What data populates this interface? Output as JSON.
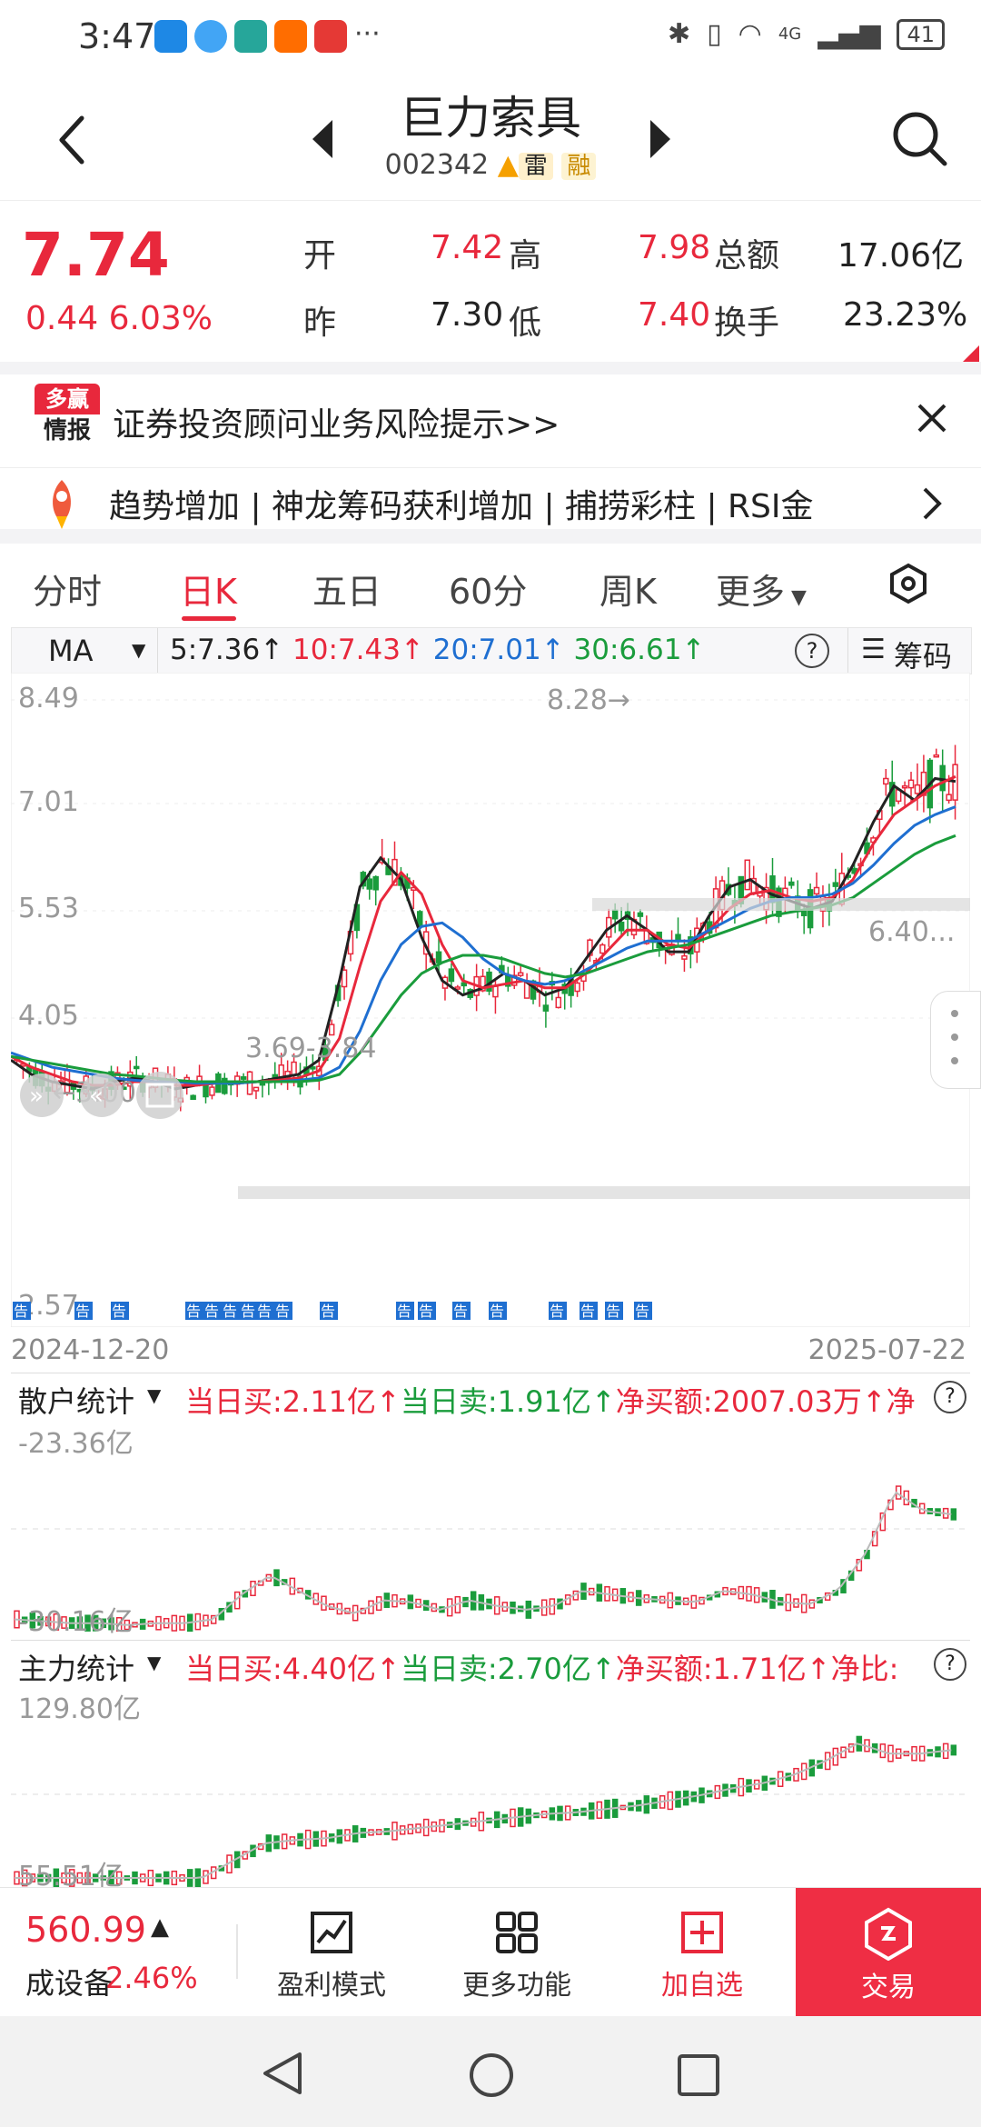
{
  "status": {
    "time": "3:47",
    "more": "···",
    "network": "4G",
    "battery": "41"
  },
  "header": {
    "name": "巨力索具",
    "code": "002342",
    "tag_lei": "雷",
    "tag_rong": "融"
  },
  "quote": {
    "price": "7.74",
    "change": "0.44",
    "change_pct": "6.03%",
    "open_label": "开",
    "open": "7.42",
    "high_label": "高",
    "high": "7.98",
    "amount_label": "总额",
    "amount": "17.06亿",
    "prev_label": "昨",
    "prev": "7.30",
    "low_label": "低",
    "low": "7.40",
    "turnover_label": "换手",
    "turnover": "23.23%"
  },
  "risk_banner": {
    "logo_top": "多赢",
    "logo_bottom": "情报",
    "text": "证券投资顾问业务风险提示>>"
  },
  "signal_banner": {
    "text": "趋势增加 | 神龙筹码获利增加 | 捕捞彩柱 | RSI金"
  },
  "tabs": [
    "分时",
    "日K",
    "五日",
    "60分",
    "周K",
    "更多"
  ],
  "ma_bar": {
    "label": "MA",
    "ma5": "5:7.36↑",
    "ma10": "10:7.43↑",
    "ma20": "20:7.01↑",
    "ma30": "30:6.61↑",
    "help": "?",
    "chips": "筹码"
  },
  "kline": {
    "y_labels": [
      "8.49",
      "7.01",
      "5.53",
      "4.05",
      "2.57"
    ],
    "high_marker": "8.28→",
    "low_marker": "←3.00",
    "band_upper": "6.40...",
    "band_lower": "3.69-3.84",
    "notice": "告",
    "start_date": "2024-12-20",
    "end_date": "2025-07-22"
  },
  "retail": {
    "title": "散户统计",
    "buy": "当日买:2.11亿↑",
    "sell": "当日卖:1.91亿↑",
    "net": "净买额:2007.03万↑",
    "net_more": "净",
    "y_top": "-23.36亿",
    "y_bottom": "-30.16亿",
    "help": "?"
  },
  "main_force": {
    "title": "主力统计",
    "buy": "当日买:4.40亿↑",
    "sell": "当日卖:2.70亿↑",
    "net": "净买额:1.71亿↑",
    "net_more": "净比:",
    "y_top": "129.80亿",
    "y_bottom": "55.51亿",
    "help": "?"
  },
  "bottom_bar": {
    "index_value": "560.99",
    "index_name": "成设备",
    "index_pct": "2.46%",
    "btn1": "盈利模式",
    "btn2": "更多功能",
    "btn3": "加自选",
    "btn4": "交易"
  },
  "chart_data": {
    "type": "candlestick",
    "title": "",
    "x_range": [
      "2024-12-20",
      "2025-07-22"
    ],
    "ylim": [
      2.57,
      8.49
    ],
    "y_ticks": [
      8.49,
      7.01,
      5.53,
      4.05,
      2.57
    ],
    "annotations": [
      {
        "label": "8.28→",
        "value": 8.28
      },
      {
        "label": "←3.00",
        "value": 3.0
      },
      {
        "label": "6.40...",
        "value": 6.4
      },
      {
        "label": "3.69-3.84",
        "range": [
          3.69,
          3.84
        ]
      }
    ],
    "series": [
      {
        "name": "5",
        "last": 7.36,
        "color": "#222222",
        "values": [
          3.5,
          3.3,
          3.2,
          3.15,
          3.1,
          3.2,
          3.25,
          3.2,
          3.1,
          3.15,
          3.2,
          3.18,
          3.2,
          3.25,
          3.3,
          3.5,
          4.6,
          5.9,
          6.3,
          6.0,
          5.2,
          4.6,
          4.4,
          4.5,
          4.7,
          4.6,
          4.4,
          4.5,
          4.9,
          5.3,
          5.5,
          5.3,
          5.0,
          5.0,
          5.5,
          5.9,
          6.0,
          5.8,
          5.7,
          5.6,
          5.7,
          6.2,
          6.8,
          7.3,
          7.1,
          7.4,
          7.36
        ]
      },
      {
        "name": "10",
        "last": 7.43,
        "color": "#e8283c",
        "values": [
          3.55,
          3.4,
          3.3,
          3.2,
          3.15,
          3.15,
          3.2,
          3.2,
          3.15,
          3.15,
          3.18,
          3.2,
          3.2,
          3.22,
          3.25,
          3.35,
          3.8,
          4.8,
          5.7,
          6.1,
          5.8,
          5.1,
          4.6,
          4.5,
          4.55,
          4.6,
          4.5,
          4.5,
          4.7,
          5.0,
          5.3,
          5.3,
          5.1,
          5.05,
          5.3,
          5.6,
          5.8,
          5.85,
          5.75,
          5.7,
          5.75,
          6.0,
          6.5,
          6.9,
          7.1,
          7.3,
          7.43
        ]
      },
      {
        "name": "20",
        "last": 7.01,
        "color": "#1f6fd1",
        "values": [
          3.6,
          3.5,
          3.4,
          3.35,
          3.3,
          3.25,
          3.22,
          3.2,
          3.2,
          3.18,
          3.18,
          3.18,
          3.2,
          3.2,
          3.22,
          3.25,
          3.4,
          3.9,
          4.6,
          5.1,
          5.35,
          5.4,
          5.2,
          4.9,
          4.7,
          4.6,
          4.55,
          4.6,
          4.75,
          4.9,
          5.05,
          5.15,
          5.15,
          5.15,
          5.3,
          5.45,
          5.6,
          5.7,
          5.75,
          5.75,
          5.8,
          5.95,
          6.2,
          6.5,
          6.75,
          6.9,
          7.01
        ]
      },
      {
        "name": "30",
        "last": 6.61,
        "color": "#1a9c3c",
        "values": [
          3.55,
          3.5,
          3.45,
          3.4,
          3.35,
          3.3,
          3.28,
          3.25,
          3.22,
          3.2,
          3.2,
          3.2,
          3.2,
          3.2,
          3.2,
          3.22,
          3.3,
          3.6,
          4.0,
          4.4,
          4.7,
          4.85,
          4.95,
          4.95,
          4.9,
          4.8,
          4.7,
          4.65,
          4.7,
          4.8,
          4.9,
          5.0,
          5.05,
          5.1,
          5.2,
          5.3,
          5.4,
          5.5,
          5.55,
          5.6,
          5.65,
          5.75,
          5.95,
          6.15,
          6.35,
          6.5,
          6.61
        ]
      }
    ]
  }
}
